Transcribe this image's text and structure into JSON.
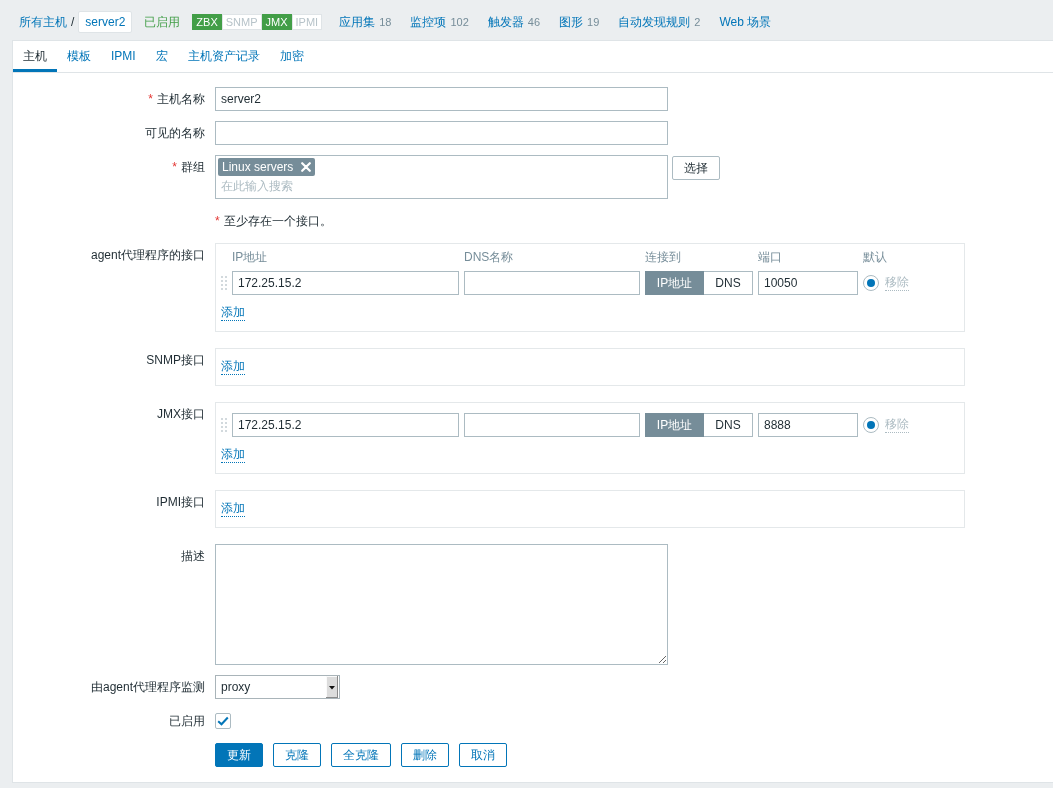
{
  "header": {
    "breadcrumbs": [
      {
        "label": "所有主机",
        "kind": "link"
      },
      {
        "label": "server2",
        "kind": "current"
      }
    ],
    "separator": "/",
    "status": {
      "label": "已启用",
      "enabled": true
    },
    "availability": [
      {
        "label": "ZBX",
        "on": true
      },
      {
        "label": "SNMP",
        "on": false
      },
      {
        "label": "JMX",
        "on": true
      },
      {
        "label": "IPMI",
        "on": false
      }
    ],
    "links": [
      {
        "label": "应用集",
        "count": "18"
      },
      {
        "label": "监控项",
        "count": "102"
      },
      {
        "label": "触发器",
        "count": "46"
      },
      {
        "label": "图形",
        "count": "19"
      },
      {
        "label": "自动发现规则",
        "count": "2"
      },
      {
        "label": "Web 场景"
      }
    ]
  },
  "tabs": [
    {
      "label": "主机",
      "selected": true
    },
    {
      "label": "模板",
      "selected": false
    },
    {
      "label": "IPMI",
      "selected": false
    },
    {
      "label": "宏",
      "selected": false
    },
    {
      "label": "主机资产记录",
      "selected": false
    },
    {
      "label": "加密",
      "selected": false
    }
  ],
  "form": {
    "host_name": {
      "label": "主机名称",
      "required_mark": "*",
      "value": "server2"
    },
    "visible_name": {
      "label": "可见的名称"
    },
    "groups": {
      "label": "群组",
      "required_mark": "*",
      "tags": [
        {
          "label": "Linux servers"
        }
      ],
      "placeholder": "在此输入搜索",
      "select_button": "选择"
    },
    "interface_note": {
      "required_mark": "*",
      "text": "至少存在一个接口。"
    },
    "interfaces": [
      {
        "label": "agent代理程序的接口",
        "columns": [
          "IP地址",
          "DNS名称",
          "连接到",
          "端口",
          "默认"
        ],
        "rows": [
          {
            "ip": "172.25.15.2",
            "connect": [
              {
                "label": "IP地址",
                "selected": true
              },
              {
                "label": "DNS",
                "selected": false
              }
            ],
            "port": "10050",
            "default": true,
            "remove": {
              "label": "移除",
              "disabled": true
            }
          }
        ],
        "add_link": "添加"
      },
      {
        "label": "SNMP接口",
        "add_link": "添加"
      },
      {
        "label": "JMX接口",
        "rows": [
          {
            "ip": "172.25.15.2",
            "connect": [
              {
                "label": "IP地址",
                "selected": true
              },
              {
                "label": "DNS",
                "selected": false
              }
            ],
            "port": "8888",
            "default": true,
            "remove": {
              "label": "移除",
              "disabled": true
            }
          }
        ],
        "add_link": "添加"
      },
      {
        "label": "IPMI接口",
        "add_link": "添加"
      }
    ],
    "description": {
      "label": "描述"
    },
    "proxy": {
      "label": "由agent代理程序监测",
      "value": "proxy"
    },
    "enabled": {
      "label": "已启用",
      "checked": true
    },
    "buttons": [
      {
        "label": "更新",
        "kind": "primary"
      },
      {
        "label": "克隆",
        "kind": "secondary"
      },
      {
        "label": "全克隆",
        "kind": "secondary"
      },
      {
        "label": "删除",
        "kind": "secondary"
      },
      {
        "label": "取消",
        "kind": "secondary"
      }
    ]
  }
}
